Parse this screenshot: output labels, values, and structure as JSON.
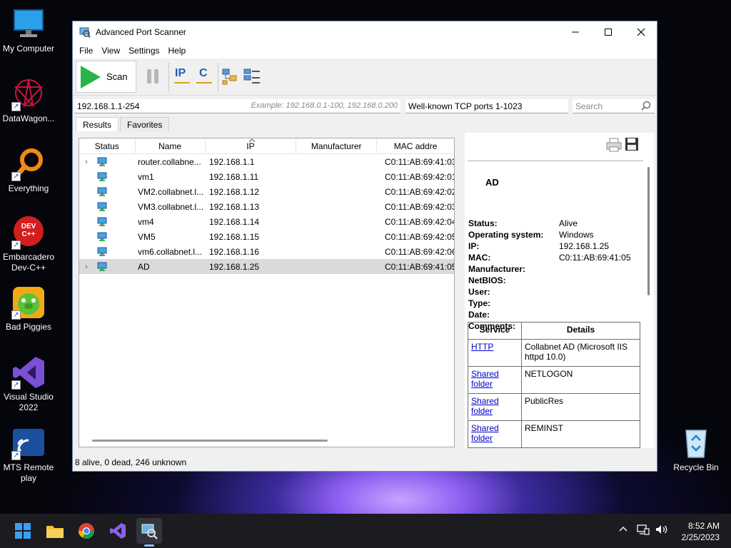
{
  "desktop": {
    "icons": [
      {
        "label": "My Computer"
      },
      {
        "label": "DataWagon..."
      },
      {
        "label": "Everything"
      },
      {
        "label_line1": "Embarcadero",
        "label_line2": "Dev-C++"
      },
      {
        "label": "Bad Piggies"
      },
      {
        "label_line1": "Visual Studio",
        "label_line2": "2022"
      },
      {
        "label_line1": "MTS Remote",
        "label_line2": "play"
      },
      {
        "label": "Recycle Bin"
      }
    ],
    "devcpp_badge": "DEV C++"
  },
  "window": {
    "title": "Advanced Port Scanner",
    "menu": [
      "File",
      "View",
      "Settings",
      "Help"
    ],
    "toolbar": {
      "scan_label": "Scan",
      "ip_label": "IP",
      "c_label": "C"
    },
    "ip_range": "192.168.1.1-254",
    "ip_example": "Example: 192.168.0.1-100, 192.168.0.200",
    "ports": "Well-known TCP ports 1-1023",
    "search_placeholder": "Search",
    "tabs": [
      "Results",
      "Favorites"
    ],
    "columns": [
      "Status",
      "Name",
      "IP",
      "Manufacturer",
      "MAC addre"
    ],
    "rows": [
      {
        "name": "router.collabne...",
        "ip": "192.168.1.1",
        "mac": "C0:11:AB:69:41:03",
        "expandable": true
      },
      {
        "name": "vm1",
        "ip": "192.168.1.11",
        "mac": "C0:11:AB:69:42:01",
        "expandable": false
      },
      {
        "name": "VM2.collabnet.l...",
        "ip": "192.168.1.12",
        "mac": "C0:11:AB:69:42:02",
        "expandable": false
      },
      {
        "name": "VM3.collabnet.l...",
        "ip": "192.168.1.13",
        "mac": "C0:11:AB:69:42:03",
        "expandable": false
      },
      {
        "name": "vm4",
        "ip": "192.168.1.14",
        "mac": "C0:11:AB:69:42:04",
        "expandable": false
      },
      {
        "name": "VM5",
        "ip": "192.168.1.15",
        "mac": "C0:11:AB:69:42:05",
        "expandable": false
      },
      {
        "name": "vm6.collabnet.l...",
        "ip": "192.168.1.16",
        "mac": "C0:11:AB:69:42:06",
        "expandable": false
      },
      {
        "name": "AD",
        "ip": "192.168.1.25",
        "mac": "C0:11:AB:69:41:05",
        "expandable": true,
        "selected": true
      }
    ],
    "details": {
      "host": "AD",
      "fields": [
        {
          "k": "Status:",
          "v": "Alive"
        },
        {
          "k": "Operating system:",
          "v": "Windows"
        },
        {
          "k": "IP:",
          "v": "192.168.1.25"
        },
        {
          "k": "MAC:",
          "v": "C0:11:AB:69:41:05"
        },
        {
          "k": "Manufacturer:",
          "v": ""
        },
        {
          "k": "NetBIOS:",
          "v": ""
        },
        {
          "k": "User:",
          "v": ""
        },
        {
          "k": "Type:",
          "v": ""
        },
        {
          "k": "Date:",
          "v": ""
        },
        {
          "k": "Comments:",
          "v": ""
        }
      ],
      "service_header": "Service",
      "details_header": "Details",
      "services": [
        {
          "service_line1": "HTTP",
          "service_line2": "",
          "detail": "Collabnet AD (Microsoft IIS httpd 10.0)"
        },
        {
          "service_line1": "Shared",
          "service_line2": "folder",
          "detail": "NETLOGON"
        },
        {
          "service_line1": "Shared",
          "service_line2": "folder",
          "detail": "PublicRes"
        },
        {
          "service_line1": "Shared",
          "service_line2": "folder",
          "detail": "REMINST"
        }
      ]
    },
    "status": "8 alive, 0 dead, 246 unknown"
  },
  "taskbar": {
    "time": "8:52 AM",
    "date": "2/25/2023"
  },
  "colors": {
    "scan_green": "#28b44a",
    "link": "#0000cc",
    "taskbar": "#1b1b20"
  }
}
